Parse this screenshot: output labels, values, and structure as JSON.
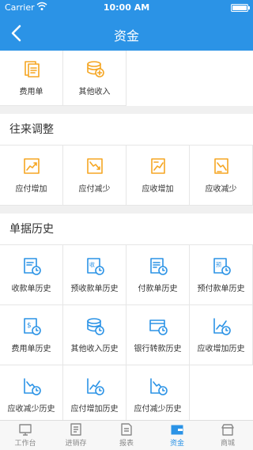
{
  "status_bar": {
    "carrier": "Carrier",
    "time": "10:00 AM"
  },
  "nav": {
    "title": "资金"
  },
  "colors": {
    "primary": "#2b93e6",
    "orange": "#f5a623",
    "blue": "#2b93e6"
  },
  "top_grid": [
    {
      "label": "费用单",
      "icon": "document-icon"
    },
    {
      "label": "其他收入",
      "icon": "coins-plus-icon"
    }
  ],
  "sections": [
    {
      "title": "往来调整",
      "items": [
        {
          "label": "应付增加",
          "icon": "trend-up-icon"
        },
        {
          "label": "应付减少",
          "icon": "trend-down-icon"
        },
        {
          "label": "应收增加",
          "icon": "doc-trend-up-icon"
        },
        {
          "label": "应收减少",
          "icon": "doc-trend-down-icon"
        }
      ]
    },
    {
      "title": "单据历史",
      "items": [
        {
          "label": "收款单历史",
          "icon": "receipt-clock-icon"
        },
        {
          "label": "预收款单历史",
          "icon": "prereceipt-clock-icon"
        },
        {
          "label": "付款单历史",
          "icon": "payment-clock-icon"
        },
        {
          "label": "预付款单历史",
          "icon": "prepayment-clock-icon"
        },
        {
          "label": "费用单历史",
          "icon": "expense-clock-icon"
        },
        {
          "label": "其他收入历史",
          "icon": "coins-clock-icon"
        },
        {
          "label": "银行转款历史",
          "icon": "card-clock-icon"
        },
        {
          "label": "应收增加历史",
          "icon": "up-chart-clock-icon"
        },
        {
          "label": "应收减少历史",
          "icon": "down-chart-clock-icon"
        },
        {
          "label": "应付增加历史",
          "icon": "up-chart-clock-icon"
        },
        {
          "label": "应付减少历史",
          "icon": "down-chart-clock-icon"
        }
      ]
    }
  ],
  "tabs": [
    {
      "label": "工作台",
      "icon": "monitor-icon",
      "active": false
    },
    {
      "label": "进销存",
      "icon": "ledger-icon",
      "active": false
    },
    {
      "label": "报表",
      "icon": "report-icon",
      "active": false
    },
    {
      "label": "资金",
      "icon": "wallet-icon",
      "active": true
    },
    {
      "label": "商城",
      "icon": "store-icon",
      "active": false
    }
  ]
}
